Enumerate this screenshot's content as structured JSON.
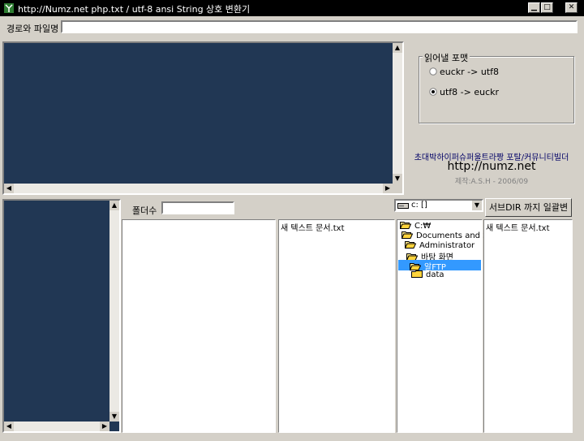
{
  "window": {
    "title": "http://Numz.net  php.txt  / utf-8 ansi String 상호 변환기",
    "min_glyph": "▁",
    "max_glyph": "□",
    "close_glyph": "✕"
  },
  "path_bar": {
    "label": "경로와 파일명",
    "value": ""
  },
  "format_group": {
    "title": "읽어낼 포맷",
    "options": [
      {
        "label": "euckr -> utf8",
        "selected": false
      },
      {
        "label": "utf8 -> euckr",
        "selected": true
      }
    ]
  },
  "credits": {
    "line1": "초대박하이퍼슈퍼울트라짱 포탈/커뮤니티빌더",
    "line2": "http://numz.net",
    "line3": "제작:A.S.H - 2006/09"
  },
  "folder_count": {
    "label": "폴더수",
    "value": ""
  },
  "drive_select": {
    "value": "c: []"
  },
  "batch_button": {
    "label": "서브DIR 까지 일괄변환"
  },
  "file_list_left": {
    "items": [
      "새 텍스트 문서.txt"
    ]
  },
  "file_list_right": {
    "items": [
      "새 텍스트 문서.txt"
    ]
  },
  "dir_tree": {
    "items": [
      {
        "label": "C:₩",
        "level": 0,
        "selected": false
      },
      {
        "label": "Documents and Se",
        "level": 1,
        "selected": false
      },
      {
        "label": "Administrator",
        "level": 2,
        "selected": false
      },
      {
        "label": "바탕 화면",
        "level": 3,
        "selected": false
      },
      {
        "label": "알FTP",
        "level": 4,
        "selected": true
      },
      {
        "label": "data",
        "level": 5,
        "selected": false
      }
    ]
  },
  "colors": {
    "panel_navy": "#213754",
    "window_gray": "#d4d0c8",
    "selection_blue": "#3399ff"
  }
}
